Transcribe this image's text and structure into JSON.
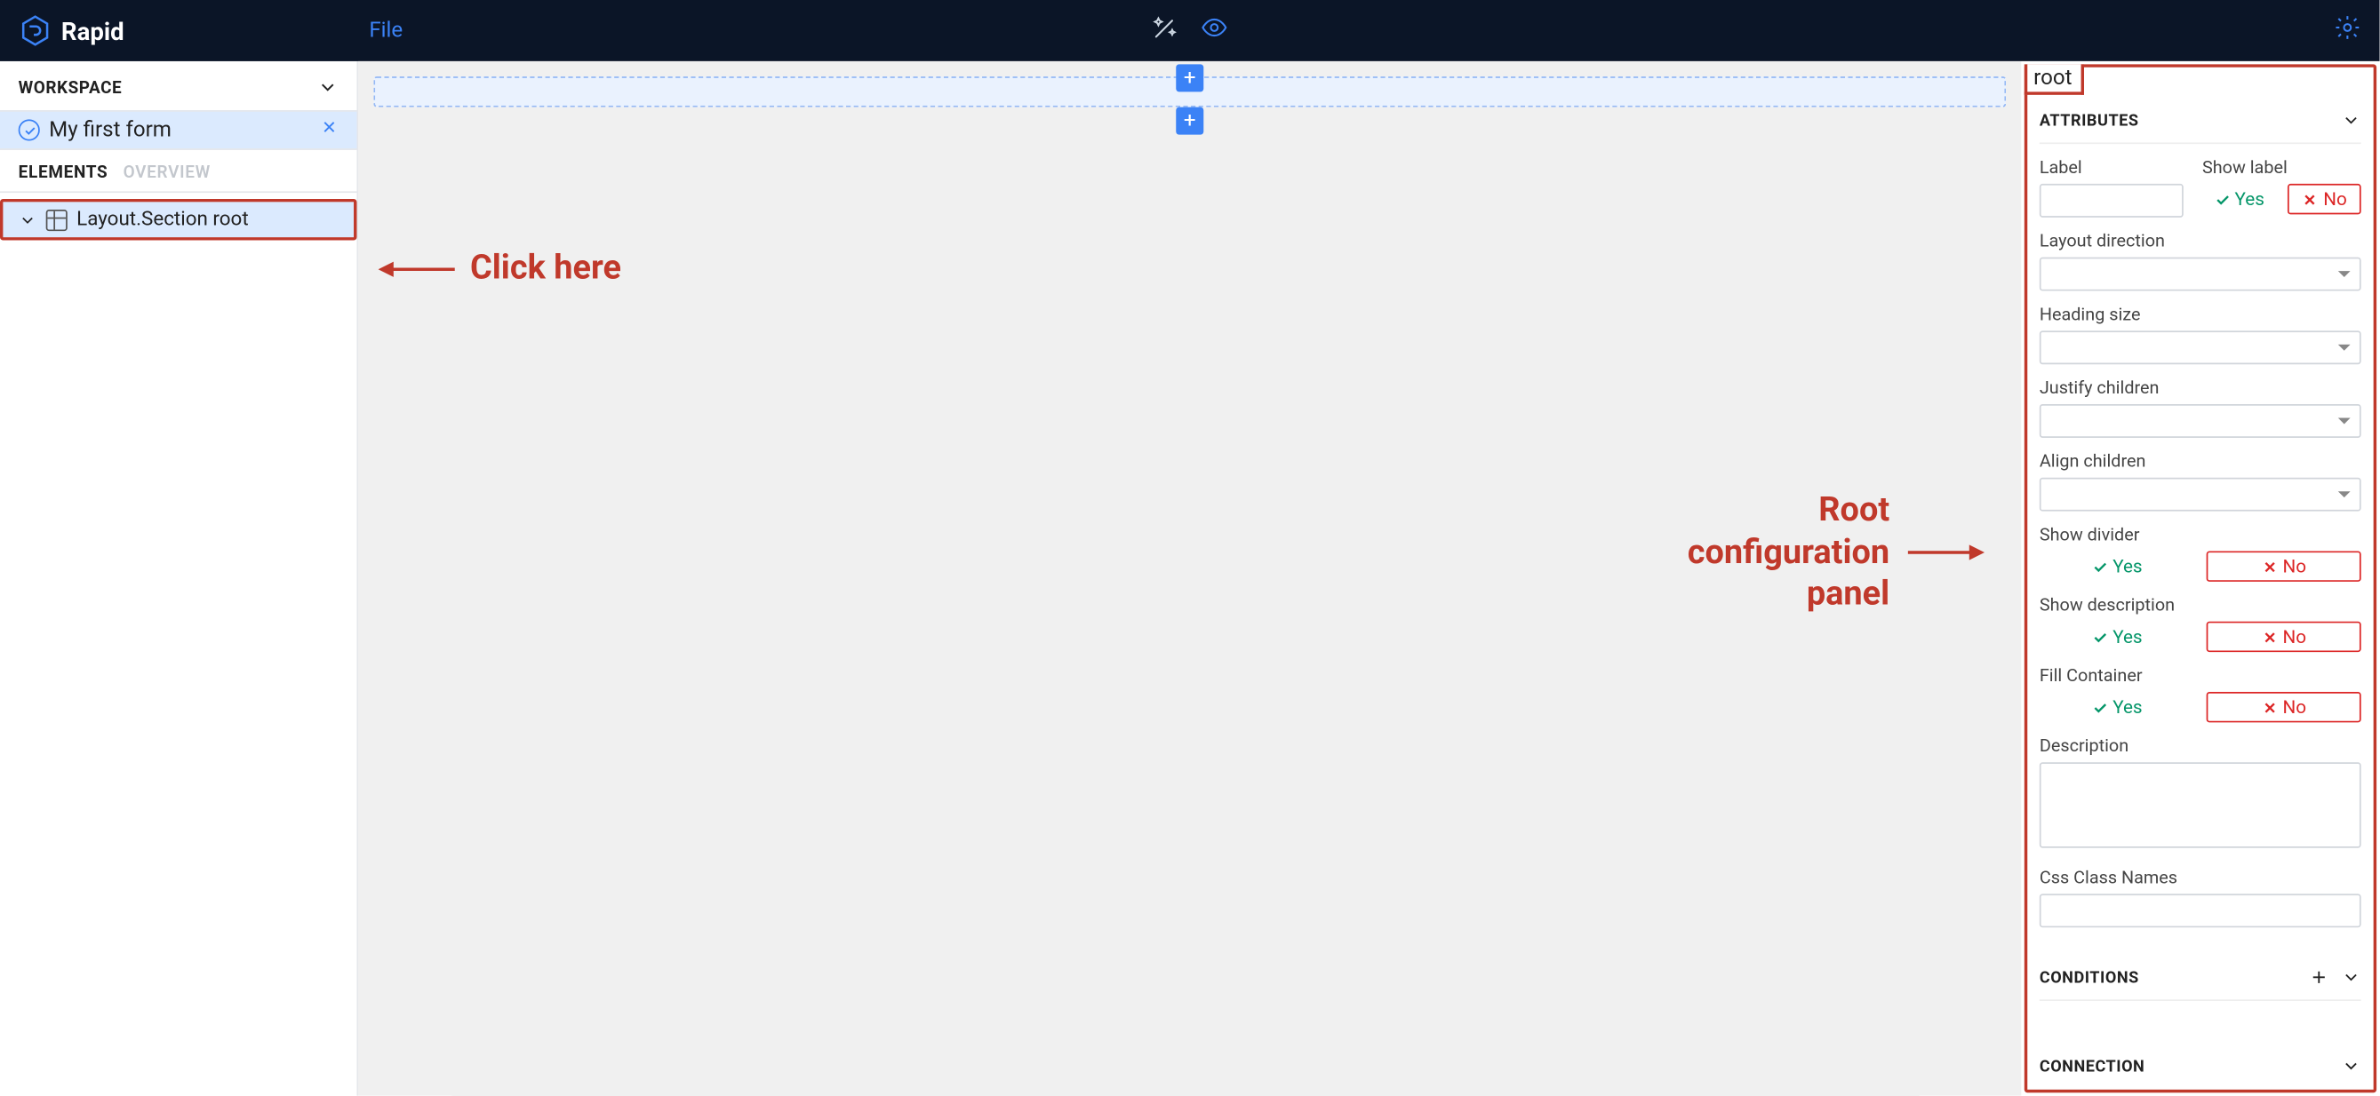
{
  "app": {
    "brand": "Rapid",
    "menu_file": "File"
  },
  "sidebar": {
    "workspace_header": "WORKSPACE",
    "workspace_item": "My first form",
    "tab_elements": "ELEMENTS",
    "tab_overview": "OVERVIEW",
    "tree_root": "Layout.Section root"
  },
  "right_panel": {
    "tab_label": "root",
    "section_attributes": "ATTRIBUTES",
    "section_conditions": "CONDITIONS",
    "section_connection": "CONNECTION",
    "labels": {
      "label": "Label",
      "show_label": "Show label",
      "layout_direction": "Layout direction",
      "heading_size": "Heading size",
      "justify_children": "Justify children",
      "align_children": "Align children",
      "show_divider": "Show divider",
      "show_description": "Show description",
      "fill_container": "Fill Container",
      "description": "Description",
      "css_class": "Css Class Names"
    },
    "yes": "Yes",
    "no": "No"
  },
  "annotations": {
    "click_here": "Click here",
    "root_panel_l1": "Root",
    "root_panel_l2": "configuration",
    "root_panel_l3": "panel"
  }
}
